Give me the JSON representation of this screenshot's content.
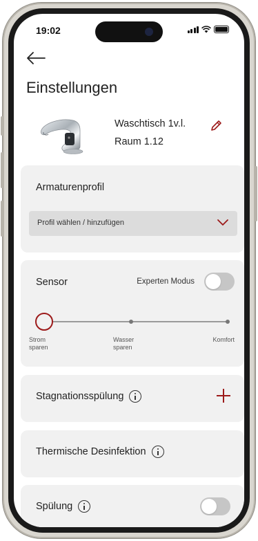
{
  "status_bar": {
    "time": "19:02"
  },
  "header": {
    "title": "Einstellungen"
  },
  "device": {
    "name": "Waschtisch 1v.l.",
    "room": "Raum 1.12"
  },
  "armaturenprofil": {
    "label": "Armaturenprofil",
    "select_placeholder": "Profil wählen / hinzufügen"
  },
  "sensor": {
    "label": "Sensor",
    "expert_mode_label": "Experten Modus",
    "expert_mode_on": false,
    "slider": {
      "selected_index": 0,
      "options": [
        {
          "line1": "Strom",
          "line2": "sparen"
        },
        {
          "line1": "Wasser",
          "line2": "sparen"
        },
        {
          "line1": "Komfort",
          "line2": ""
        }
      ]
    }
  },
  "stagnation": {
    "label": "Stagnationsspülung"
  },
  "thermal": {
    "label": "Thermische Desinfektion"
  },
  "rinse": {
    "label": "Spülung",
    "toggle_on": false
  },
  "colors": {
    "accent": "#9c1a1a",
    "card_bg": "#f1f1f1",
    "select_bg": "#dcdcdc"
  },
  "icons": [
    "back-arrow-icon",
    "faucet-image",
    "edit-pencil-icon",
    "chevron-down-icon",
    "info-icon",
    "plus-icon"
  ]
}
